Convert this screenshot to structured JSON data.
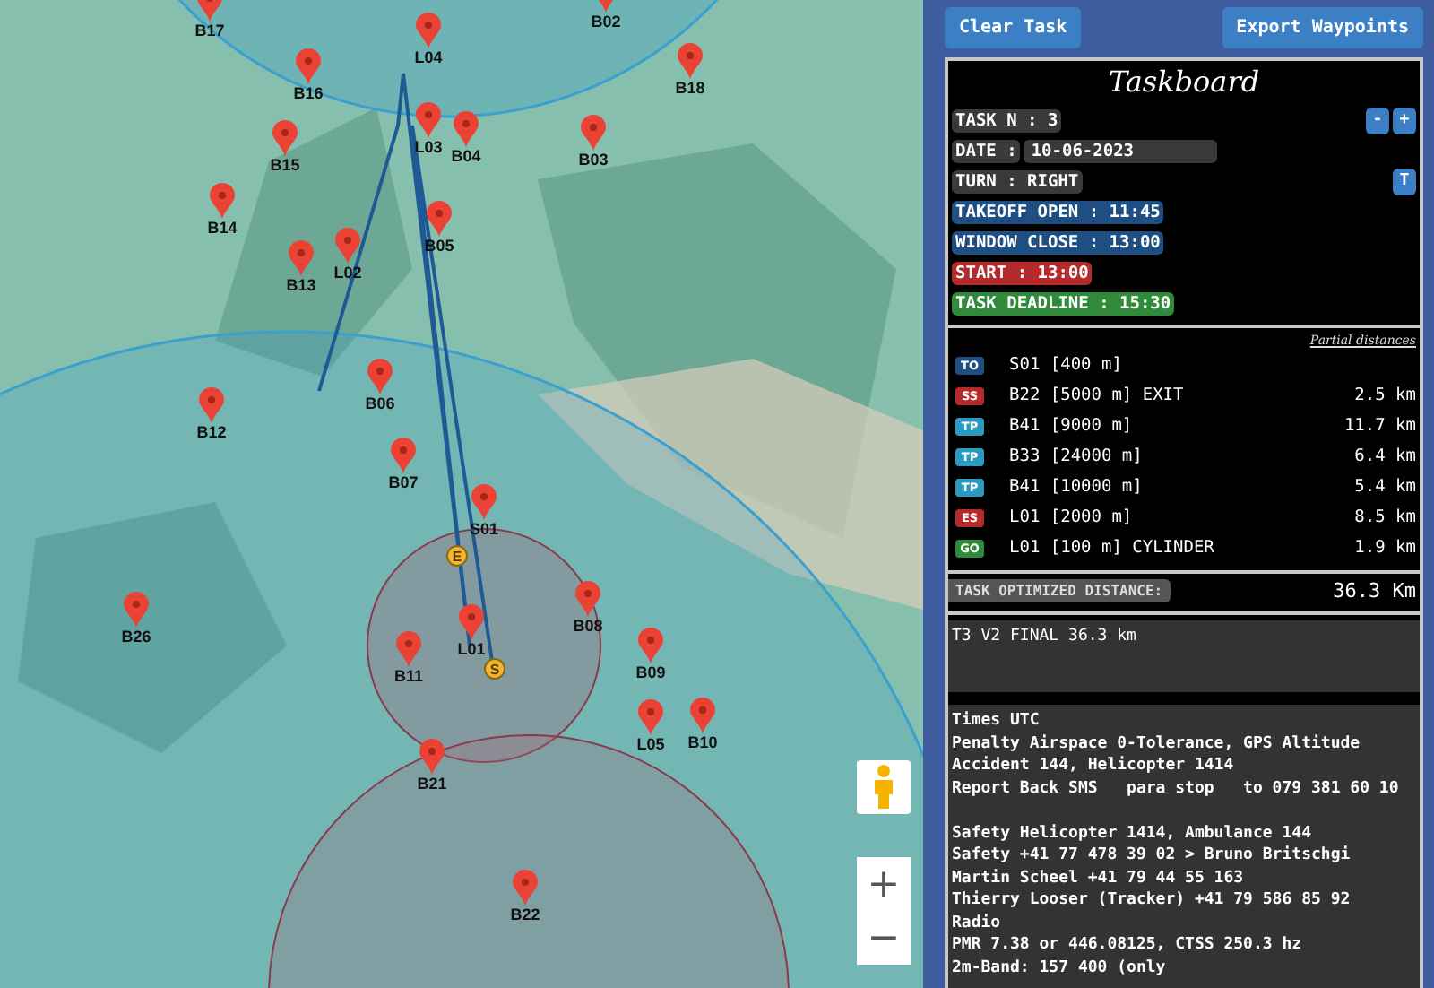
{
  "map": {
    "waypoints": [
      {
        "label": "B17"
      },
      {
        "label": "B02"
      },
      {
        "label": "L04"
      },
      {
        "label": "B16"
      },
      {
        "label": "B18"
      },
      {
        "label": "L03"
      },
      {
        "label": "B04"
      },
      {
        "label": "B15"
      },
      {
        "label": "B03"
      },
      {
        "label": "B14"
      },
      {
        "label": "B05"
      },
      {
        "label": "L02"
      },
      {
        "label": "B13"
      },
      {
        "label": "B06"
      },
      {
        "label": "B12"
      },
      {
        "label": "B07"
      },
      {
        "label": "S01"
      },
      {
        "label": "B26"
      },
      {
        "label": "L01"
      },
      {
        "label": "B11"
      },
      {
        "label": "B08"
      },
      {
        "label": "B09"
      },
      {
        "label": "L05"
      },
      {
        "label": "B10"
      },
      {
        "label": "B21"
      },
      {
        "label": "B22"
      }
    ],
    "route_markers": [
      {
        "label": "E"
      },
      {
        "label": "S"
      }
    ],
    "zoom_in": "+",
    "zoom_out": "−"
  },
  "toolbar": {
    "buttons": [
      "Clear Task",
      "Export Waypoints"
    ]
  },
  "taskboard": {
    "title": "Taskboard",
    "rows": [
      {
        "kind": "neutral",
        "text": "TASK N : 3",
        "controls": [
          "-",
          "+"
        ]
      },
      {
        "kind": "date",
        "label": "DATE :",
        "value": "10-06-2023"
      },
      {
        "kind": "neutral",
        "text": "TURN : RIGHT",
        "controls": [
          "T"
        ]
      },
      {
        "kind": "blue",
        "text": "TAKEOFF OPEN : 11:45"
      },
      {
        "kind": "blue",
        "text": "WINDOW CLOSE : 13:00"
      },
      {
        "kind": "red",
        "text": "START : 13:00"
      },
      {
        "kind": "green",
        "text": "TASK DEADLINE : 15:30"
      }
    ],
    "partial_label": "Partial distances",
    "turnpoints": [
      {
        "kind": "takeoff",
        "badge": "TO",
        "name": "S01 [400 m]"
      },
      {
        "kind": "start",
        "badge": "SS",
        "name": "B22 [5000 m] EXIT",
        "distance": "2.5 km"
      },
      {
        "kind": "turnpoint",
        "badge": "TP",
        "name": "B41 [9000 m]",
        "distance": "11.7 km"
      },
      {
        "kind": "turnpoint",
        "badge": "TP",
        "name": "B33 [24000 m]",
        "distance": "6.4 km"
      },
      {
        "kind": "turnpoint",
        "badge": "TP",
        "name": "B41 [10000 m]",
        "distance": "5.4 km"
      },
      {
        "kind": "end",
        "badge": "ES",
        "name": "L01 [2000 m]",
        "distance": "8.5 km"
      },
      {
        "kind": "goal",
        "badge": "GO",
        "name": "L01 [100 m] CYLINDER",
        "distance": "1.9 km"
      }
    ],
    "distance_label": "TASK OPTIMIZED DISTANCE:",
    "distance_value": "36.3 Km",
    "task_name": "T3 V2 FINAL 36.3 km",
    "notes": "Times UTC\nPenalty Airspace 0-Tolerance, GPS Altitude\nAccident 144, Helicopter 1414\nReport Back SMS   para stop   to 079 381 60 10\n\nSafety Helicopter 1414, Ambulance 144\nSafety +41 77 478 39 02 > Bruno Britschgi\nMartin Scheel +41 79 44 55 163\nThierry Looser (Tracker) +41 79 586 85 92\nRadio\nPMR 7.38 or 446.08125, CTSS 250.3 hz\n2m-Band: 157 400 (only"
  }
}
